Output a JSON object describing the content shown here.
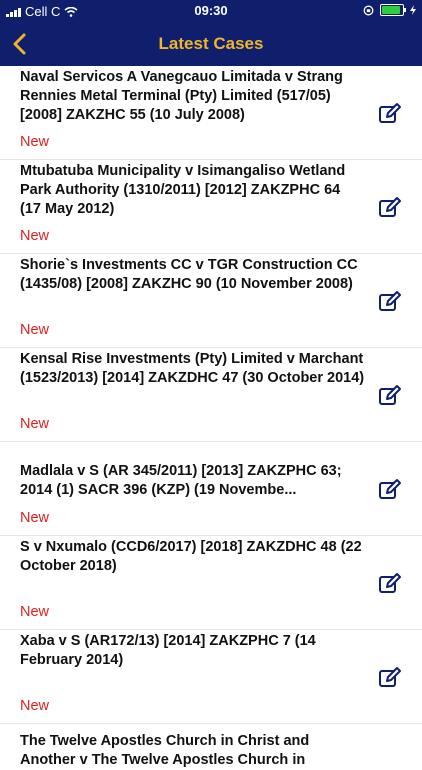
{
  "status": {
    "carrier": "Cell C",
    "time": "09:30"
  },
  "nav": {
    "title": "Latest Cases"
  },
  "cases": [
    {
      "title": "Naval Servicos A Vanegcauo Limitada v Strang Rennies Metal Terminal (Pty) Limited (517/05) [2008] ZAKZHC 55 (10 July 2008)",
      "badge": "New"
    },
    {
      "title": "Mtubatuba Municipality v Isimangaliso Wetland Park Authority (1310/2011) [2012] ZAKZPHC 64 (17 May 2012)",
      "badge": "New"
    },
    {
      "title": "Shorie`s Investments CC v TGR Construction CC (1435/08) [2008] ZAKZHC 90 (10 November 2008)",
      "badge": "New"
    },
    {
      "title": "Kensal Rise Investments (Pty) Limited v Marchant (1523/2013) [2014] ZAKZDHC 47 (30 October 2014)",
      "badge": "New"
    },
    {
      "title": "Madlala v S (AR 345/2011) [2013] ZAKZPHC 63; 2014 (1) SACR 396 (KZP) (19 Novembe...",
      "badge": "New"
    },
    {
      "title": "S v Nxumalo (CCD6/2017) [2018] ZAKZDHC 48 (22 October 2018)",
      "badge": "New"
    },
    {
      "title": "Xaba v S (AR172/13) [2014] ZAKZPHC 7 (14 February 2014)",
      "badge": "New"
    },
    {
      "title": "The Twelve Apostles Church in Christ and Another v The Twelve Apostles Church in",
      "badge": ""
    }
  ],
  "colors": {
    "bar": "#0f1f6b",
    "accent": "#f0b429",
    "badge": "#e02020",
    "icon": "#0f1f6b"
  },
  "icons": {
    "back": "chevron-left-icon",
    "edit": "edit-icon"
  }
}
